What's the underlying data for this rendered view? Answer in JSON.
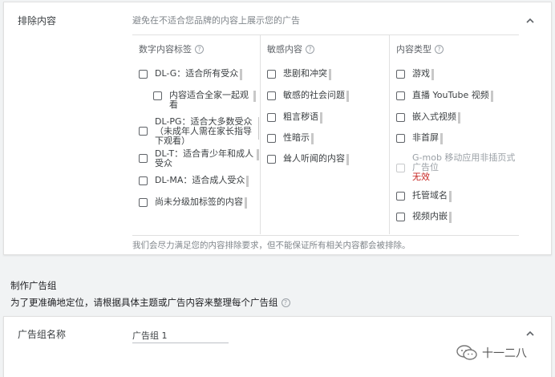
{
  "exclusion": {
    "title": "排除内容",
    "description": "避免在不适合您品牌的内容上展示您的广告",
    "footer_note": "我们会尽力满足您的内容排除要求，但不能保证所有相关内容都会被排除。",
    "columns": [
      {
        "header": "数字内容标签",
        "options": [
          {
            "label": "DL-G：适合所有受众"
          },
          {
            "label": "内容适合全家一起观看"
          },
          {
            "label": "DL-PG：适合大多数受众（未成年人需在家长指导下观看）"
          },
          {
            "label": "DL-T：适合青少年和成人受众"
          },
          {
            "label": "DL-MA：适合成人受众"
          },
          {
            "label": "尚未分级加标签的内容"
          }
        ]
      },
      {
        "header": "敏感内容",
        "options": [
          {
            "label": "悲剧和冲突"
          },
          {
            "label": "敏感的社会问题"
          },
          {
            "label": "粗言秽语"
          },
          {
            "label": "性暗示"
          },
          {
            "label": "耸人听闻的内容"
          }
        ]
      },
      {
        "header": "内容类型",
        "options": [
          {
            "label": "游戏"
          },
          {
            "label": "直播 YouTube 视频"
          },
          {
            "label": "嵌入式视频"
          },
          {
            "label": "非首屏"
          },
          {
            "label": "G-mob 移动应用非插页式广告位",
            "note": "无效",
            "disabled": true
          },
          {
            "label": "托管域名"
          },
          {
            "label": "视频内嵌"
          }
        ]
      }
    ]
  },
  "adgroup_section": {
    "title": "制作广告组",
    "subtitle": "为了更准确地定位，请根据具体主题或广告内容来整理每个广告组"
  },
  "adgroup_card": {
    "label": "广告组名称",
    "value": "广告组 1"
  },
  "watermark": {
    "text": "十一二八",
    "icon": "wechat-icon"
  },
  "icons": {
    "collapse": "chevron-up-icon",
    "help": "help-circle-icon"
  }
}
